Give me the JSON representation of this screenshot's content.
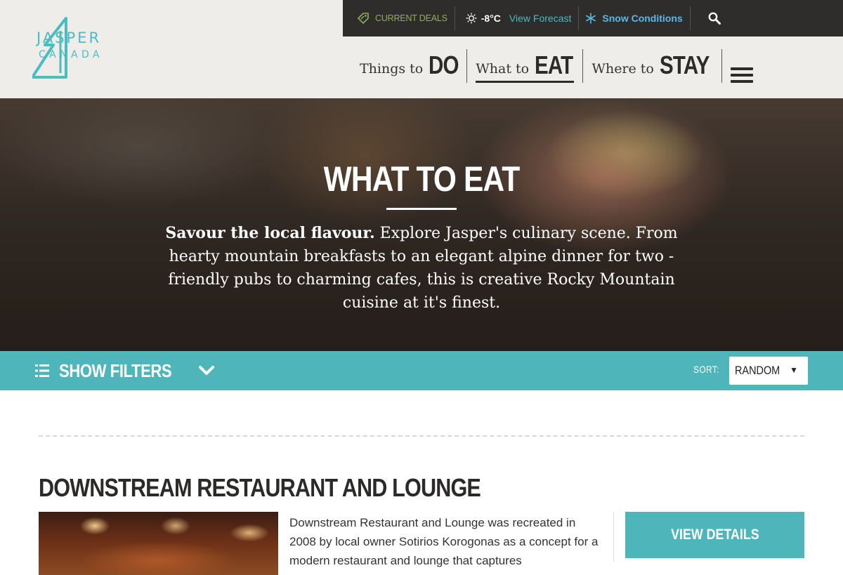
{
  "brand": {
    "logo_line1": "JASPER",
    "logo_line2": "CANADA",
    "accent_color": "#4eb6bb"
  },
  "utility_bar": {
    "deals_label": "CURRENT DEALS",
    "temperature": "-8°C",
    "forecast_link": "View Forecast",
    "snow_link": "Snow Conditions",
    "icons": [
      "tag-icon",
      "sun-icon",
      "snowflake-icon",
      "search-icon"
    ]
  },
  "main_nav": [
    {
      "small": "Things to",
      "big": "DO"
    },
    {
      "small": "What to",
      "big": "EAT",
      "active": true
    },
    {
      "small": "Where to",
      "big": "STAY"
    }
  ],
  "hero": {
    "title": "WHAT TO EAT",
    "lead_bold": "Savour the local flavour.",
    "lead_text": " Explore Jasper's culinary scene. From hearty mountain breakfasts to an elegant alpine dinner for two - friendly pubs to charming cafes, this is creative Rocky Mountain cuisine at it's finest."
  },
  "filter_bar": {
    "show_filters_label": "SHOW FILTERS",
    "sort_label": "SORT:",
    "sort_value": "RANDOM"
  },
  "listing": {
    "title": "DOWNSTREAM RESTAURANT AND LOUNGE",
    "description": "Downstream Restaurant and Lounge was recreated in 2008 by local owner Sotirios Korogonas as a concept for a modern restaurant and lounge that captures",
    "button_label": "VIEW DETAILS"
  }
}
